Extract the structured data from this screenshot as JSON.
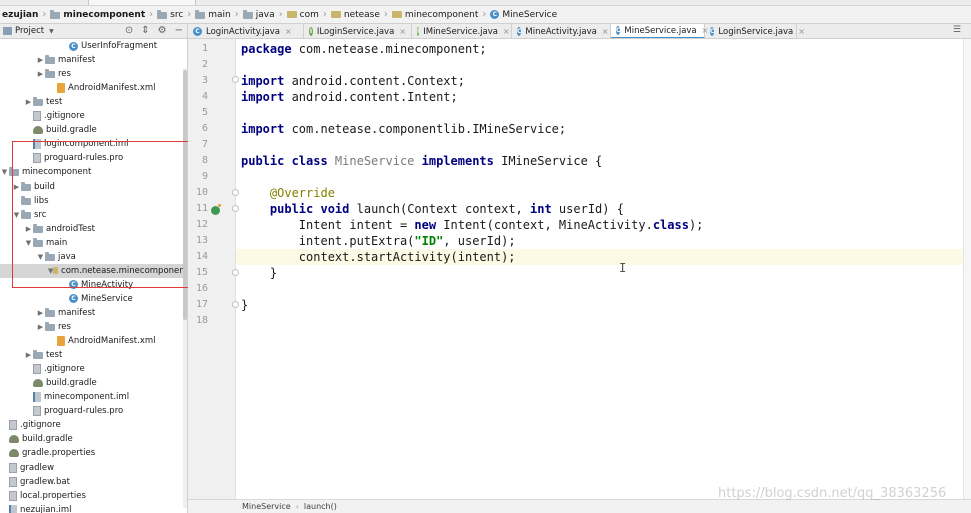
{
  "window_tab": "minecomponent",
  "breadcrumb": [
    "ezujian",
    "minecomponent",
    "src",
    "main",
    "java",
    "com",
    "netease",
    "minecomponent",
    "MineService"
  ],
  "panel": {
    "title": "Project"
  },
  "tree": [
    {
      "label": "UserInfoFragment",
      "icon": "class-icon",
      "depth": 5,
      "arrow": ""
    },
    {
      "label": "manifest",
      "icon": "folder-icon",
      "depth": 3,
      "arrow": "▶"
    },
    {
      "label": "res",
      "icon": "folder-icon",
      "depth": 3,
      "arrow": "▶"
    },
    {
      "label": "AndroidManifest.xml",
      "icon": "xml-file-icon",
      "depth": 4,
      "arrow": ""
    },
    {
      "label": "test",
      "icon": "folder-icon",
      "depth": 2,
      "arrow": "▶"
    },
    {
      "label": ".gitignore",
      "icon": "file-icon",
      "depth": 2,
      "arrow": ""
    },
    {
      "label": "build.gradle",
      "icon": "gradle-icon",
      "depth": 2,
      "arrow": ""
    },
    {
      "label": "logincomponent.iml",
      "icon": "iml-icon",
      "depth": 2,
      "arrow": ""
    },
    {
      "label": "proguard-rules.pro",
      "icon": "file-icon",
      "depth": 2,
      "arrow": ""
    },
    {
      "label": "minecomponent",
      "icon": "folder-icon",
      "depth": 0,
      "arrow": "▼"
    },
    {
      "label": "build",
      "icon": "folder-icon",
      "depth": 1,
      "arrow": "▶"
    },
    {
      "label": "libs",
      "icon": "folder-icon",
      "depth": 1,
      "arrow": ""
    },
    {
      "label": "src",
      "icon": "folder-icon",
      "depth": 1,
      "arrow": "▼"
    },
    {
      "label": "androidTest",
      "icon": "folder-icon",
      "depth": 2,
      "arrow": "▶"
    },
    {
      "label": "main",
      "icon": "folder-icon",
      "depth": 2,
      "arrow": "▼"
    },
    {
      "label": "java",
      "icon": "folder-icon",
      "depth": 3,
      "arrow": "▼"
    },
    {
      "label": "com.netease.minecomponent",
      "icon": "package-icon",
      "depth": 4,
      "arrow": "▼",
      "selected": true
    },
    {
      "label": "MineActivity",
      "icon": "class-icon",
      "depth": 5,
      "arrow": ""
    },
    {
      "label": "MineService",
      "icon": "class-icon",
      "depth": 5,
      "arrow": ""
    },
    {
      "label": "manifest",
      "icon": "folder-icon",
      "depth": 3,
      "arrow": "▶"
    },
    {
      "label": "res",
      "icon": "folder-icon",
      "depth": 3,
      "arrow": "▶"
    },
    {
      "label": "AndroidManifest.xml",
      "icon": "xml-file-icon",
      "depth": 4,
      "arrow": ""
    },
    {
      "label": "test",
      "icon": "folder-icon",
      "depth": 2,
      "arrow": "▶"
    },
    {
      "label": ".gitignore",
      "icon": "file-icon",
      "depth": 2,
      "arrow": ""
    },
    {
      "label": "build.gradle",
      "icon": "gradle-icon",
      "depth": 2,
      "arrow": ""
    },
    {
      "label": "minecomponent.iml",
      "icon": "iml-icon",
      "depth": 2,
      "arrow": ""
    },
    {
      "label": "proguard-rules.pro",
      "icon": "file-icon",
      "depth": 2,
      "arrow": ""
    },
    {
      "label": ".gitignore",
      "icon": "file-icon",
      "depth": 0,
      "arrow": ""
    },
    {
      "label": "build.gradle",
      "icon": "gradle-icon",
      "depth": 0,
      "arrow": ""
    },
    {
      "label": "gradle.properties",
      "icon": "gradle-icon",
      "depth": 0,
      "arrow": ""
    },
    {
      "label": "gradlew",
      "icon": "file-icon",
      "depth": 0,
      "arrow": ""
    },
    {
      "label": "gradlew.bat",
      "icon": "file-icon",
      "depth": 0,
      "arrow": ""
    },
    {
      "label": "local.properties",
      "icon": "file-icon",
      "depth": 0,
      "arrow": ""
    },
    {
      "label": "nezujian.iml",
      "icon": "iml-icon",
      "depth": 0,
      "arrow": ""
    }
  ],
  "tabs": [
    {
      "label": "LoginActivity.java",
      "icon": "class-icon"
    },
    {
      "label": "ILoginService.java",
      "icon": "interface-icon"
    },
    {
      "label": "IMineService.java",
      "icon": "interface-icon"
    },
    {
      "label": "MineActivity.java",
      "icon": "class-icon"
    },
    {
      "label": "MineService.java",
      "icon": "class-icon",
      "active": true
    },
    {
      "label": "LoginService.java",
      "icon": "class-icon"
    }
  ],
  "code": {
    "line_numbers": [
      "1",
      "2",
      "3",
      "4",
      "5",
      "6",
      "7",
      "8",
      "9",
      "10",
      "11",
      "12",
      "13",
      "14",
      "15",
      "16",
      "17",
      "18"
    ],
    "l1": {
      "kw": "package",
      "rest": " com.netease.minecomponent;"
    },
    "l3": {
      "kw": "import",
      "rest": " android.content.Context;"
    },
    "l4": {
      "kw": "import",
      "rest": " android.content.Intent;"
    },
    "l6": {
      "kw": "import",
      "rest": " com.netease.componentlib.IMineService;"
    },
    "l8": {
      "kw1": "public class",
      "name": " MineService ",
      "kw2": "implements",
      "rest": " IMineService {"
    },
    "l10": {
      "ann": "    @Override"
    },
    "l11": {
      "pre": "    ",
      "kw": "public void",
      "mid": " launch(Context context, ",
      "kw2": "int",
      "rest": " userId) {"
    },
    "l12": {
      "pre": "        Intent intent = ",
      "kw": "new",
      "mid": " Intent(context, MineActivity.",
      "kw2": "class",
      "rest": ");"
    },
    "l13": {
      "pre": "        intent.putExtra(",
      "str": "\"ID\"",
      "rest": ", userId);"
    },
    "l14": {
      "text": "        context.startActivity(intent);"
    },
    "l15": {
      "text": "    }"
    },
    "l17": {
      "text": "}"
    }
  },
  "bottom_breadcrumb": [
    "MineService",
    "launch()"
  ],
  "watermark": "https://blog.csdn.net/qq_38363256"
}
